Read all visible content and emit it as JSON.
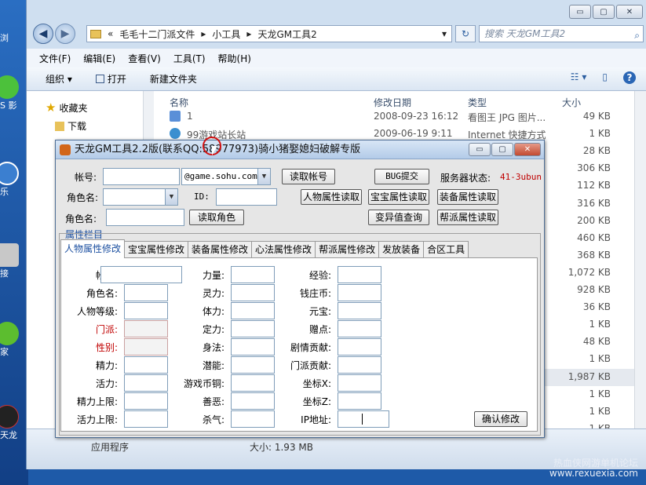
{
  "desktop": {
    "items": [
      {
        "label": "浏"
      },
      {
        "label": "S 影"
      },
      {
        "label": "乐"
      },
      {
        "label": "接"
      },
      {
        "label": "家"
      },
      {
        "label": "天龙"
      }
    ]
  },
  "explorer": {
    "title_buttons": {
      "minimize": "▭",
      "maximize": "▢",
      "close": "✕"
    },
    "back_icon": "◀",
    "forward_icon": "▶",
    "address": {
      "chevron": "«",
      "crumbs": [
        "毛毛十二门派文件",
        "小工具",
        "天龙GM工具2"
      ],
      "sep": "▸",
      "dropdown": "▾"
    },
    "refresh_icon": "↻",
    "search_placeholder": "搜索 天龙GM工具2",
    "search_icon": "⌕",
    "menu": [
      "文件(F)",
      "编辑(E)",
      "查看(V)",
      "工具(T)",
      "帮助(H)"
    ],
    "toolbar": {
      "organize": "组织 ▾",
      "open": "打开",
      "new_folder": "新建文件夹",
      "view_icon": "☷ ▾",
      "pane_icon": "▯",
      "help_icon": "?"
    },
    "nav": {
      "favorites": "收藏夹",
      "downloads": "下载"
    },
    "columns": {
      "name": "名称",
      "modified": "修改日期",
      "type": "类型",
      "size": "大小"
    },
    "files": [
      {
        "name": "1",
        "date": "2008-09-23 16:12",
        "type": "看图王 JPG 图片...",
        "size": "49 KB"
      },
      {
        "name": "99游戏站长站",
        "date": "2009-06-19 9:11",
        "type": "Internet 快捷方式",
        "size": "1 KB"
      },
      {
        "name": "",
        "date": "",
        "type": "",
        "size": "28 KB"
      },
      {
        "name": "",
        "date": "",
        "type": "",
        "size": "306 KB"
      },
      {
        "name": "",
        "date": "",
        "type": "",
        "size": "112 KB"
      },
      {
        "name": "",
        "date": "",
        "type": "",
        "size": "316 KB"
      },
      {
        "name": "",
        "date": "",
        "type": "",
        "size": "200 KB"
      },
      {
        "name": "",
        "date": "",
        "type": "",
        "size": "460 KB"
      },
      {
        "name": "",
        "date": "",
        "type": "",
        "size": "368 KB"
      },
      {
        "name": "",
        "date": "",
        "type": "",
        "size": "1,072 KB"
      },
      {
        "name": "",
        "date": "",
        "type": "",
        "size": "928 KB"
      },
      {
        "name": "",
        "date": "",
        "type": "",
        "size": "36 KB"
      },
      {
        "name": "",
        "date": "",
        "type": "",
        "size": "1 KB"
      },
      {
        "name": "",
        "date": "",
        "type": "",
        "size": "48 KB"
      },
      {
        "name": "",
        "date": "",
        "type": "",
        "size": "1 KB"
      },
      {
        "name": "",
        "date": "",
        "type": "",
        "size": "1,987 KB"
      },
      {
        "name": "",
        "date": "",
        "type": "",
        "size": "1 KB"
      },
      {
        "name": "",
        "date": "",
        "type": "",
        "size": "1 KB"
      },
      {
        "name": "",
        "date": "",
        "type": "",
        "size": "1 KB"
      }
    ],
    "status": {
      "type": "应用程序",
      "size": "大小: 1.93 MB"
    }
  },
  "dialog": {
    "title": "天龙GM工具2.2版(联系QQ:58977973)骑小猪娶媳妇破解专版",
    "top": {
      "account_label": "帐号:",
      "domain_value": "@game.sohu.com",
      "read_account": "读取帐号",
      "bug_submit": "BUG提交",
      "server_status_label": "服务器状态:",
      "server_status_value": "41-3ubun",
      "role_label": "角色名:",
      "id_label": "ID:",
      "read_char_attr": "人物属性读取",
      "read_pet_attr": "宝宝属性读取",
      "read_equip_attr": "装备属性读取",
      "role_label2": "角色名:",
      "read_role": "读取角色",
      "var_query": "变异值查询",
      "read_guild_attr": "帮派属性读取",
      "attr_column": "属性栏目"
    },
    "tabs": [
      "人物属性修改",
      "宝宝属性修改",
      "装备属性修改",
      "心法属性修改",
      "帮派属性修改",
      "发放装备",
      "合区工具"
    ],
    "form": {
      "col1": [
        "帐号:",
        "角色名:",
        "人物等级:",
        "门派:",
        "性别:",
        "精力:",
        "活力:",
        "精力上限:",
        "活力上限:"
      ],
      "col2": [
        "力量:",
        "灵力:",
        "体力:",
        "定力:",
        "身法:",
        "潜能:",
        "游戏币铜:",
        "善恶:",
        "杀气:"
      ],
      "col3": [
        "经验:",
        "钱庄币:",
        "元宝:",
        "赠点:",
        "剧情贡献:",
        "门派贡献:",
        "坐标X:",
        "坐标Z:",
        "IP地址:"
      ],
      "confirm": "确认修改"
    }
  },
  "watermark": {
    "line1": "热血侠网游单机论坛",
    "line2": "www.rexuexia.com"
  }
}
